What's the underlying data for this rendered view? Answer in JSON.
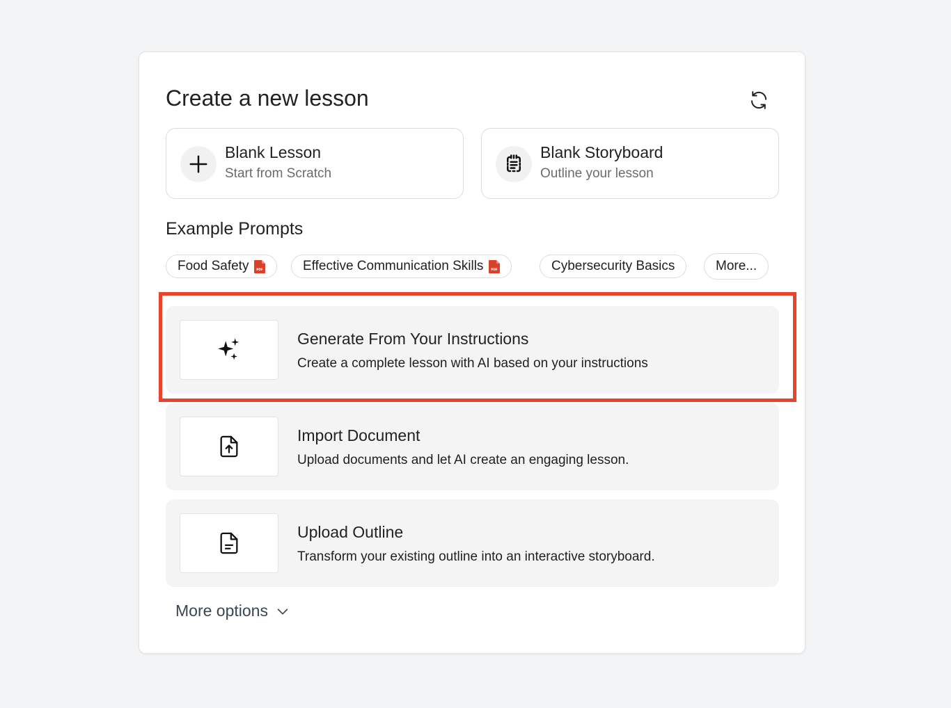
{
  "dialog": {
    "title": "Create a new lesson",
    "refresh_icon": "refresh-icon"
  },
  "blank": [
    {
      "title": "Blank Lesson",
      "subtitle": "Start from Scratch",
      "icon": "plus-icon"
    },
    {
      "title": "Blank Storyboard",
      "subtitle": "Outline your lesson",
      "icon": "storyboard-icon"
    }
  ],
  "examples": {
    "title": "Example Prompts",
    "chips": [
      {
        "label": "Food Safety",
        "badge": "pdf-icon"
      },
      {
        "label": "Effective Communication Skills",
        "badge": "pdf-icon"
      },
      {
        "label": "Cybersecurity Basics"
      },
      {
        "label": "More..."
      }
    ],
    "badge_text": "PDF"
  },
  "options": [
    {
      "title": "Generate From Your Instructions",
      "desc": "Create a complete lesson with AI based on your instructions",
      "icon": "sparkles-icon"
    },
    {
      "title": "Import Document",
      "desc": "Upload documents and let AI create an engaging lesson.",
      "icon": "file-upload-icon"
    },
    {
      "title": "Upload Outline",
      "desc": "Transform your existing outline into an interactive storyboard.",
      "icon": "file-text-icon"
    }
  ],
  "more_options": {
    "label": "More options",
    "icon": "chevron-down-icon"
  },
  "colors": {
    "highlight": "#e8432d",
    "pdf": "#d9412b",
    "option_bg": "#f4f4f4"
  }
}
